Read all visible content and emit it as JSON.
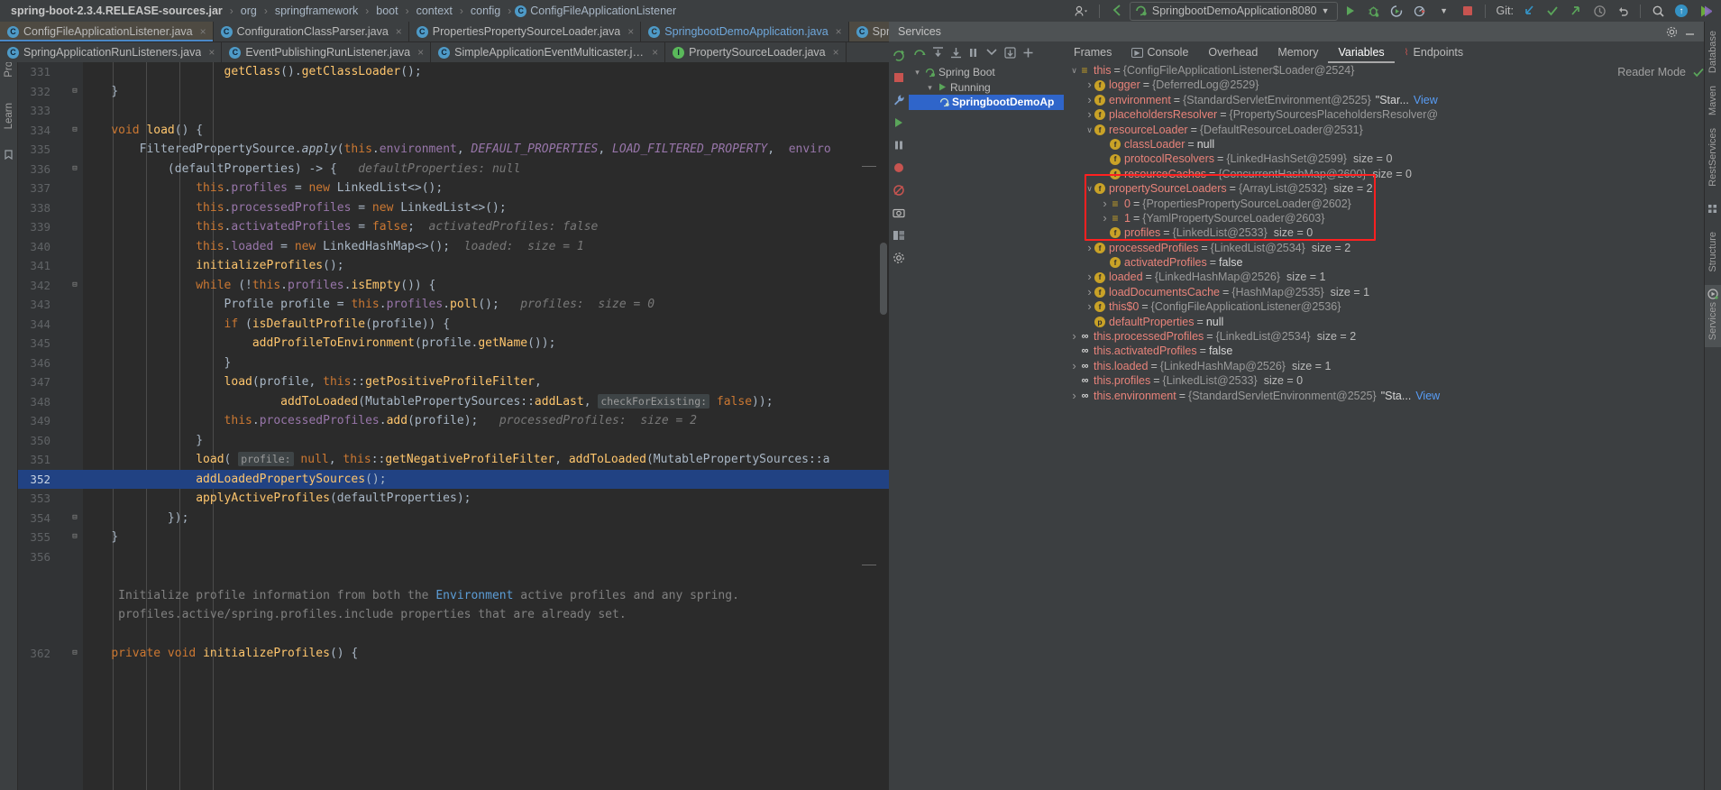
{
  "navbar": {
    "breadcrumbs": [
      {
        "label": "spring-boot-2.3.4.RELEASE-sources.jar",
        "bold": true
      },
      {
        "label": "org",
        "bold": false
      },
      {
        "label": "springframework",
        "bold": false
      },
      {
        "label": "boot",
        "bold": false
      },
      {
        "label": "context",
        "bold": false
      },
      {
        "label": "config",
        "bold": false
      },
      {
        "label": "ConfigFileApplicationListener",
        "bold": false,
        "icon": "class-icon"
      }
    ],
    "run_config": "SpringbootDemoApplication8080",
    "git_label": "Git:",
    "icons": [
      "user-avatar-icon",
      "back-arrow-icon",
      "run-icon",
      "debug-icon",
      "run-with-coverage-icon",
      "profiler-icon",
      "stop-icon",
      "git-update-icon",
      "git-commit-icon",
      "git-push-icon",
      "history-icon",
      "undo-icon",
      "search-everywhere-icon",
      "updates-icon",
      "ide-features-icon"
    ]
  },
  "editor_tabs": {
    "row1": [
      {
        "label": "ConfigFileApplicationListener.java",
        "icon": "class-icon",
        "selected": true,
        "active": true
      },
      {
        "label": "ConfigurationClassParser.java",
        "icon": "class-icon",
        "selected": false,
        "active": false
      },
      {
        "label": "PropertiesPropertySourceLoader.java",
        "icon": "class-icon",
        "selected": false,
        "active": false
      },
      {
        "label": "SpringbootDemoApplication.java",
        "icon": "spring-class-icon",
        "selected": false,
        "active": false,
        "blue": true
      },
      {
        "label": "SpringApplication.java",
        "icon": "class-icon",
        "selected": true,
        "active": false
      }
    ],
    "row2": [
      {
        "label": "SpringApplicationRunListeners.java",
        "icon": "class-icon"
      },
      {
        "label": "EventPublishingRunListener.java",
        "icon": "class-icon"
      },
      {
        "label": "SimpleApplicationEventMulticaster.java",
        "icon": "class-icon"
      },
      {
        "label": "PropertySourceLoader.java",
        "icon": "interface-icon"
      }
    ],
    "close_glyph": "×"
  },
  "editor": {
    "reader_mode_label": "Reader Mode",
    "first_line_number": 331,
    "highlighted_line": 352,
    "lines": [
      {
        "n": 331,
        "fold": "",
        "html": "<span class='pad-s'>                    </span><span class='fn'>getClass</span><span class='bracket'>()</span><span class='txt'>.</span><span class='fn'>getClassLoader</span><span class='bracket'>()</span><span class='txt'>;</span>"
      },
      {
        "n": 332,
        "fold": "minus",
        "html": "<span class='pad-s'>    </span><span class='bracket'>}</span>"
      },
      {
        "n": 333,
        "fold": "",
        "html": ""
      },
      {
        "n": 334,
        "fold": "minus",
        "html": "<span class='pad-s'>    </span><span class='kw'>void </span><span class='fn'>load</span><span class='bracket'>() {</span>"
      },
      {
        "n": 335,
        "fold": "",
        "html": "<span class='pad-s'>        </span><span class='txt'>FilteredPropertySource.</span><span class='stat'>apply</span><span class='bracket'>(</span><span class='kw'>this</span><span class='txt'>.</span><span class='fld'>environment</span><span class='txt'>, </span><span class='const'>DEFAULT_PROPERTIES</span><span class='txt'>, </span><span class='const'>LOAD_FILTERED_PROPERTY</span><span class='txt'>,  </span><span class='fld'>enviro</span>"
      },
      {
        "n": 336,
        "fold": "minus",
        "html": "<span class='pad-s'>            </span><span class='bracket'>(</span><span class='txt'>defaultProperties</span><span class='bracket'>) -&gt; {</span><span class='hint'>   defaultProperties: null</span>"
      },
      {
        "n": 337,
        "fold": "",
        "html": "<span class='pad-s'>                </span><span class='kw'>this</span><span class='txt'>.</span><span class='fld'>profiles</span><span class='txt'> = </span><span class='kw'>new </span><span class='txt'>LinkedList&lt;&gt;</span><span class='bracket'>()</span><span class='txt'>;</span>"
      },
      {
        "n": 338,
        "fold": "",
        "html": "<span class='pad-s'>                </span><span class='kw'>this</span><span class='txt'>.</span><span class='fld'>processedProfiles</span><span class='txt'> = </span><span class='kw'>new </span><span class='txt'>LinkedList&lt;&gt;</span><span class='bracket'>()</span><span class='txt'>;</span>"
      },
      {
        "n": 339,
        "fold": "",
        "html": "<span class='pad-s'>                </span><span class='kw'>this</span><span class='txt'>.</span><span class='fld'>activatedProfiles</span><span class='txt'> = </span><span class='kw'>false</span><span class='txt'>;</span><span class='hint'>  activatedProfiles: false</span>"
      },
      {
        "n": 340,
        "fold": "",
        "html": "<span class='pad-s'>                </span><span class='kw'>this</span><span class='txt'>.</span><span class='fld'>loaded</span><span class='txt'> = </span><span class='kw'>new </span><span class='txt'>LinkedHashMap&lt;&gt;</span><span class='bracket'>()</span><span class='txt'>;</span><span class='hint'>  loaded:  size = 1</span>"
      },
      {
        "n": 341,
        "fold": "",
        "html": "<span class='pad-s'>                </span><span class='fn'>initializeProfiles</span><span class='bracket'>()</span><span class='txt'>;</span>"
      },
      {
        "n": 342,
        "fold": "minus",
        "html": "<span class='pad-s'>                </span><span class='kw'>while </span><span class='bracket'>(</span><span class='txt'>!</span><span class='kw'>this</span><span class='txt'>.</span><span class='fld'>profiles</span><span class='txt'>.</span><span class='fn'>isEmpty</span><span class='bracket'>()) {</span>"
      },
      {
        "n": 343,
        "fold": "",
        "html": "<span class='pad-s'>                    </span><span class='txt'>Profile profile = </span><span class='kw'>this</span><span class='txt'>.</span><span class='fld'>profiles</span><span class='txt'>.</span><span class='fn'>poll</span><span class='bracket'>()</span><span class='txt'>;</span><span class='hint'>   profiles:  size = 0</span>"
      },
      {
        "n": 344,
        "fold": "",
        "html": "<span class='pad-s'>                    </span><span class='kw'>if </span><span class='bracket'>(</span><span class='fn'>isDefaultProfile</span><span class='bracket'>(</span><span class='txt'>profile</span><span class='bracket'>)) {</span>"
      },
      {
        "n": 345,
        "fold": "",
        "html": "<span class='pad-s'>                        </span><span class='fn'>addProfileToEnvironment</span><span class='bracket'>(</span><span class='txt'>profile.</span><span class='fn'>getName</span><span class='bracket'>())</span><span class='txt'>;</span>"
      },
      {
        "n": 346,
        "fold": "",
        "html": "<span class='pad-s'>                    </span><span class='bracket'>}</span>"
      },
      {
        "n": 347,
        "fold": "",
        "html": "<span class='pad-s'>                    </span><span class='fn'>load</span><span class='bracket'>(</span><span class='txt'>profile, </span><span class='kw'>this</span><span class='txt'>::</span><span class='fn'>getPositiveProfileFilter</span><span class='txt'>,</span>"
      },
      {
        "n": 348,
        "fold": "",
        "html": "<span class='pad-s'>                            </span><span class='fn'>addToLoaded</span><span class='bracket'>(</span><span class='txt'>MutablePropertySources::</span><span class='fn'>addLast</span><span class='txt'>, </span><span class='paramhint'>checkForExisting:</span><span class='kw'> false</span><span class='bracket'>))</span><span class='txt'>;</span>"
      },
      {
        "n": 349,
        "fold": "",
        "html": "<span class='pad-s'>                    </span><span class='kw'>this</span><span class='txt'>.</span><span class='fld'>processedProfiles</span><span class='txt'>.</span><span class='fn'>add</span><span class='bracket'>(</span><span class='txt'>profile</span><span class='bracket'>)</span><span class='txt'>;</span><span class='hint'>   processedProfiles:  size = 2</span>"
      },
      {
        "n": 350,
        "fold": "",
        "html": "<span class='pad-s'>                </span><span class='bracket'>}</span>"
      },
      {
        "n": 351,
        "fold": "",
        "html": "<span class='pad-s'>                </span><span class='fn'>load</span><span class='bracket'>(</span><span class='txt'> </span><span class='paramhint'>profile:</span><span class='kw'> null</span><span class='txt'>, </span><span class='kw'>this</span><span class='txt'>::</span><span class='fn'>getNegativeProfileFilter</span><span class='txt'>, </span><span class='fn'>addToLoaded</span><span class='bracket'>(</span><span class='txt'>MutablePropertySources::a</span>"
      },
      {
        "n": 352,
        "fold": "",
        "hl": true,
        "html": "<span class='pad-s'>                </span><span class='fn'>addLoadedPropertySources</span><span class='bracket'>()</span><span class='txt'>;</span>"
      },
      {
        "n": 353,
        "fold": "",
        "html": "<span class='pad-s'>                </span><span class='fn'>applyActiveProfiles</span><span class='bracket'>(</span><span class='txt'>defaultProperties</span><span class='bracket'>)</span><span class='txt'>;</span>"
      },
      {
        "n": 354,
        "fold": "minus",
        "html": "<span class='pad-s'>            </span><span class='bracket'>})</span><span class='txt'>;</span>"
      },
      {
        "n": 355,
        "fold": "minus",
        "html": "<span class='pad-s'>    </span><span class='bracket'>}</span>"
      },
      {
        "n": 356,
        "fold": "",
        "html": ""
      },
      {
        "n": "",
        "fold": "",
        "html": ""
      },
      {
        "n": "",
        "fold": "",
        "html": "<span class='pad-s'>     </span><span class='cmt'>Initialize profile information from both the </span><span class='docblue'>Environment </span><span class='cmt'>active profiles and any spring.</span>"
      },
      {
        "n": "",
        "fold": "",
        "html": "<span class='pad-s'>     </span><span class='cmt'>profiles.active/spring.profiles.include properties that are already set.</span>"
      },
      {
        "n": "",
        "fold": "",
        "html": ""
      },
      {
        "n": 362,
        "fold": "minus",
        "html": "<span class='pad-s'>    </span><span class='kw'>private void </span><span class='fn'>initializeProfiles</span><span class='bracket'>() {</span>"
      }
    ]
  },
  "services": {
    "title": "Services",
    "window_buttons": [
      "settings-icon",
      "minimize-icon",
      "hide-icon"
    ]
  },
  "debugger": {
    "vertical_tool_icons": [
      "rerun-icon",
      "stop-icon",
      "settings-wrench-icon",
      "resume-icon",
      "pause-icon",
      "mute-breakpoints-icon",
      "view-breakpoints-icon",
      "screenshot-icon",
      "layout-icon",
      "debug-settings-icon"
    ],
    "horizontal_tool_icons": [
      "step-over-icon",
      "step-into-icon",
      "force-step-into-icon",
      "step-out-icon",
      "drop-frame-icon",
      "run-to-cursor-icon",
      "evaluate-icon"
    ],
    "frames": {
      "root": "Spring Boot",
      "thread": "Running",
      "selected_frame": "SpringbootDemoAp"
    },
    "tabs": [
      {
        "label": "Frames",
        "icon": "frames-icon",
        "active": false
      },
      {
        "label": "Console",
        "icon": "console-icon",
        "active": false
      },
      {
        "label": "Overhead",
        "icon": "overhead-icon",
        "active": false
      },
      {
        "label": "Memory",
        "icon": "memory-icon",
        "active": false
      },
      {
        "label": "Variables",
        "icon": "variables-icon",
        "active": true
      },
      {
        "label": "Endpoints",
        "icon": "endpoints-icon",
        "active": false
      }
    ],
    "variables": [
      {
        "indent": 0,
        "arrow": "down",
        "icon": "obj",
        "name": "this",
        "value": "{ConfigFileApplicationListener$Loader@2524}",
        "size": "",
        "link": ""
      },
      {
        "indent": 1,
        "arrow": "right",
        "icon": "f",
        "name": "logger",
        "value": "{DeferredLog@2529}",
        "size": "",
        "link": ""
      },
      {
        "indent": 1,
        "arrow": "right",
        "icon": "f",
        "name": "environment",
        "value": "{StandardServletEnvironment@2525}",
        "str": "\"Star...",
        "size": "",
        "link": "View"
      },
      {
        "indent": 1,
        "arrow": "right",
        "icon": "f",
        "name": "placeholdersResolver",
        "value": "{PropertySourcesPlaceholdersResolver@",
        "size": "",
        "link": ""
      },
      {
        "indent": 1,
        "arrow": "down",
        "icon": "f",
        "name": "resourceLoader",
        "value": "{DefaultResourceLoader@2531}",
        "size": "",
        "link": ""
      },
      {
        "indent": 2,
        "arrow": "",
        "icon": "f",
        "name": "classLoader",
        "value": "null",
        "plain": true,
        "size": "",
        "link": ""
      },
      {
        "indent": 2,
        "arrow": "",
        "icon": "f",
        "name": "protocolResolvers",
        "value": "{LinkedHashSet@2599}",
        "size": "size = 0",
        "link": ""
      },
      {
        "indent": 2,
        "arrow": "",
        "icon": "f",
        "name": "resourceCaches",
        "value": "{ConcurrentHashMap@2600}",
        "size": "size = 0",
        "link": ""
      },
      {
        "indent": 1,
        "arrow": "down",
        "icon": "f",
        "name": "propertySourceLoaders",
        "value": "{ArrayList@2532}",
        "size": "size = 2",
        "link": ""
      },
      {
        "indent": 2,
        "arrow": "right",
        "icon": "list",
        "name": "0",
        "value": "{PropertiesPropertySourceLoader@2602}",
        "size": "",
        "link": ""
      },
      {
        "indent": 2,
        "arrow": "right",
        "icon": "list",
        "name": "1",
        "value": "{YamlPropertySourceLoader@2603}",
        "size": "",
        "link": ""
      },
      {
        "indent": 2,
        "arrow": "",
        "icon": "f",
        "name": "profiles",
        "value": "{LinkedList@2533}",
        "size": "size = 0",
        "link": ""
      },
      {
        "indent": 1,
        "arrow": "right",
        "icon": "f",
        "name": "processedProfiles",
        "value": "{LinkedList@2534}",
        "size": "size = 2",
        "link": ""
      },
      {
        "indent": 2,
        "arrow": "",
        "icon": "f",
        "name": "activatedProfiles",
        "value": "false",
        "plain": true,
        "size": "",
        "link": ""
      },
      {
        "indent": 1,
        "arrow": "right",
        "icon": "f",
        "name": "loaded",
        "value": "{LinkedHashMap@2526}",
        "size": "size = 1",
        "link": ""
      },
      {
        "indent": 1,
        "arrow": "right",
        "icon": "f",
        "name": "loadDocumentsCache",
        "value": "{HashMap@2535}",
        "size": "size = 1",
        "link": ""
      },
      {
        "indent": 1,
        "arrow": "right",
        "icon": "f",
        "name": "this$0",
        "value": "{ConfigFileApplicationListener@2536}",
        "size": "",
        "link": ""
      },
      {
        "indent": 1,
        "arrow": "",
        "icon": "p",
        "name": "defaultProperties",
        "value": "null",
        "plain": true,
        "size": "",
        "link": ""
      },
      {
        "indent": 0,
        "arrow": "right",
        "icon": "oo",
        "name": "this.processedProfiles",
        "value": "{LinkedList@2534}",
        "size": "size = 2",
        "link": ""
      },
      {
        "indent": 0,
        "arrow": "",
        "icon": "oo",
        "name": "this.activatedProfiles",
        "value": "false",
        "plain": true,
        "size": "",
        "link": ""
      },
      {
        "indent": 0,
        "arrow": "right",
        "icon": "oo",
        "name": "this.loaded",
        "value": "{LinkedHashMap@2526}",
        "size": "size = 1",
        "link": ""
      },
      {
        "indent": 0,
        "arrow": "",
        "icon": "oo",
        "name": "this.profiles",
        "value": "{LinkedList@2533}",
        "size": "size = 0",
        "link": ""
      },
      {
        "indent": 0,
        "arrow": "right",
        "icon": "oo",
        "name": "this.environment",
        "value": "{StandardServletEnvironment@2525}",
        "str": "\"Sta...",
        "size": "",
        "link": "View"
      }
    ],
    "highlight": {
      "color": "#ff2020",
      "note": "red annotation box around propertySourceLoaders subtree and profiles"
    }
  },
  "right_strip": [
    "Database",
    "Maven",
    "RestServices",
    "Structure",
    "Services"
  ],
  "left_strip": [
    "Project",
    "Learn"
  ],
  "colors": {
    "editor_bg": "#2b2b2b",
    "panel_bg": "#3c3f41",
    "selection_blue": "#214283",
    "accent_red": "#ff2020",
    "tab_selected": "#4e4a42",
    "frame_selected": "#2f65ca"
  }
}
